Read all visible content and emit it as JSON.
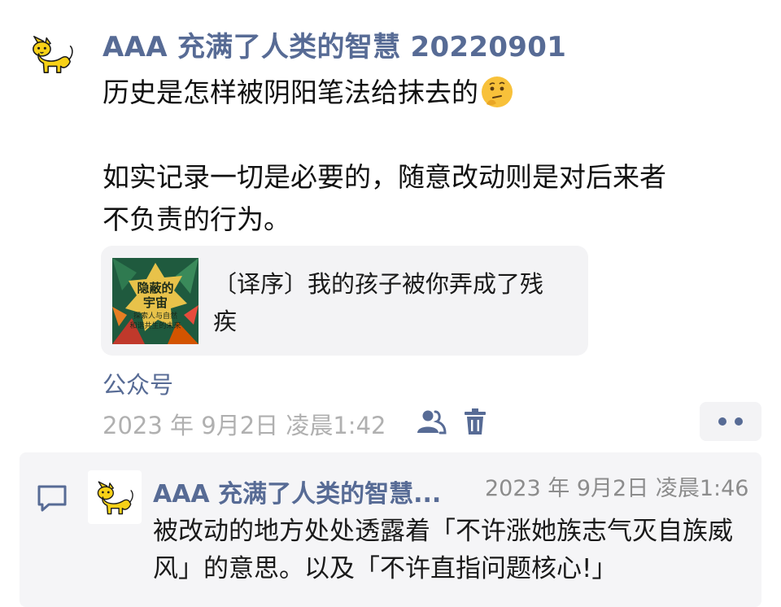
{
  "post": {
    "author": "AAA 充满了人类的智慧 20220901",
    "avatar_icon": "yellow-cat-icon",
    "lines": [
      "历史是怎样被阴阳笔法给抹去的",
      "",
      "如实记录一切是必要的，随意改动则是对后来者",
      "不负责的行为。"
    ],
    "emoji_icon": "thinking-face-emoji",
    "shared_article": {
      "title": "〔译序〕我的孩子被你弄成了残疾",
      "cover": {
        "title_line1": "隐蔽的",
        "title_line2": "宇宙",
        "subtitle_line1": "探索人与自然",
        "subtitle_line2": "和谐共生的未来"
      }
    },
    "source": "公众号",
    "timestamp": "2023 年 9月2日 凌晨1:42",
    "visibility_icon": "person-group-icon",
    "delete_icon": "trash-icon",
    "more_icon": "more-dots-icon"
  },
  "comment": {
    "comment_icon": "comment-bubble-icon",
    "author": "AAA 充满了人类的智慧...",
    "time": "2023 年 9月2日 凌晨1:46",
    "text": "被改动的地方处处透露着「不许涨她族志气灭自族威风」的意思。以及「不许直指问题核心!」"
  },
  "colors": {
    "link": "#576b95",
    "meta": "#b0b0b0",
    "card_bg": "#f3f3f5"
  }
}
